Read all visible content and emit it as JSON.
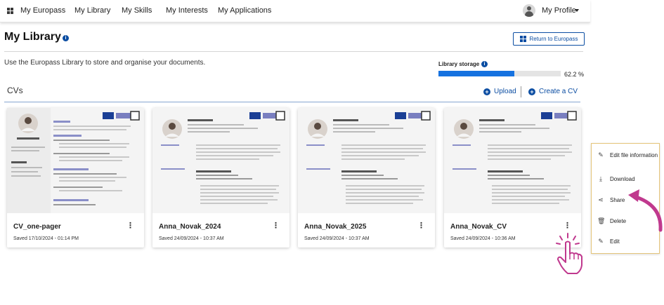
{
  "nav": {
    "items": [
      "My Europass",
      "My Library",
      "My Skills",
      "My Interests",
      "My Applications"
    ],
    "profile_label": "My Profile"
  },
  "header": {
    "title": "My Library",
    "return_button": "Return to Europass"
  },
  "description": "Use the Europass Library to store and organise your documents.",
  "storage": {
    "label": "Library storage",
    "percent_text": "62.2 %",
    "fraction": 0.622
  },
  "section": {
    "title": "CVs",
    "upload_label": "Upload",
    "create_label": "Create a CV"
  },
  "cards": [
    {
      "name": "CV_one-pager",
      "saved": "Saved 17/10/2024 - 01:14 PM"
    },
    {
      "name": "Anna_Novak_2024",
      "saved": "Saved 24/09/2024 - 10:37 AM"
    },
    {
      "name": "Anna_Novak_2025",
      "saved": "Saved 24/09/2024 - 10:37 AM"
    },
    {
      "name": "Anna_Novak_CV",
      "saved": "Saved 24/09/2024 - 10:36 AM"
    }
  ],
  "context_menu": {
    "items": [
      {
        "label": "Edit file information",
        "icon": "pencil-icon"
      },
      {
        "label": "Download",
        "icon": "download-icon"
      },
      {
        "label": "Share",
        "icon": "share-icon"
      },
      {
        "label": "Delete",
        "icon": "trash-icon"
      },
      {
        "label": "Edit",
        "icon": "pencil-icon"
      }
    ]
  },
  "colors": {
    "brand_blue": "#0b4da2",
    "storage_fill": "#1672e0",
    "pointer_arrow": "#c0398e",
    "menu_border": "#e5c57a"
  }
}
